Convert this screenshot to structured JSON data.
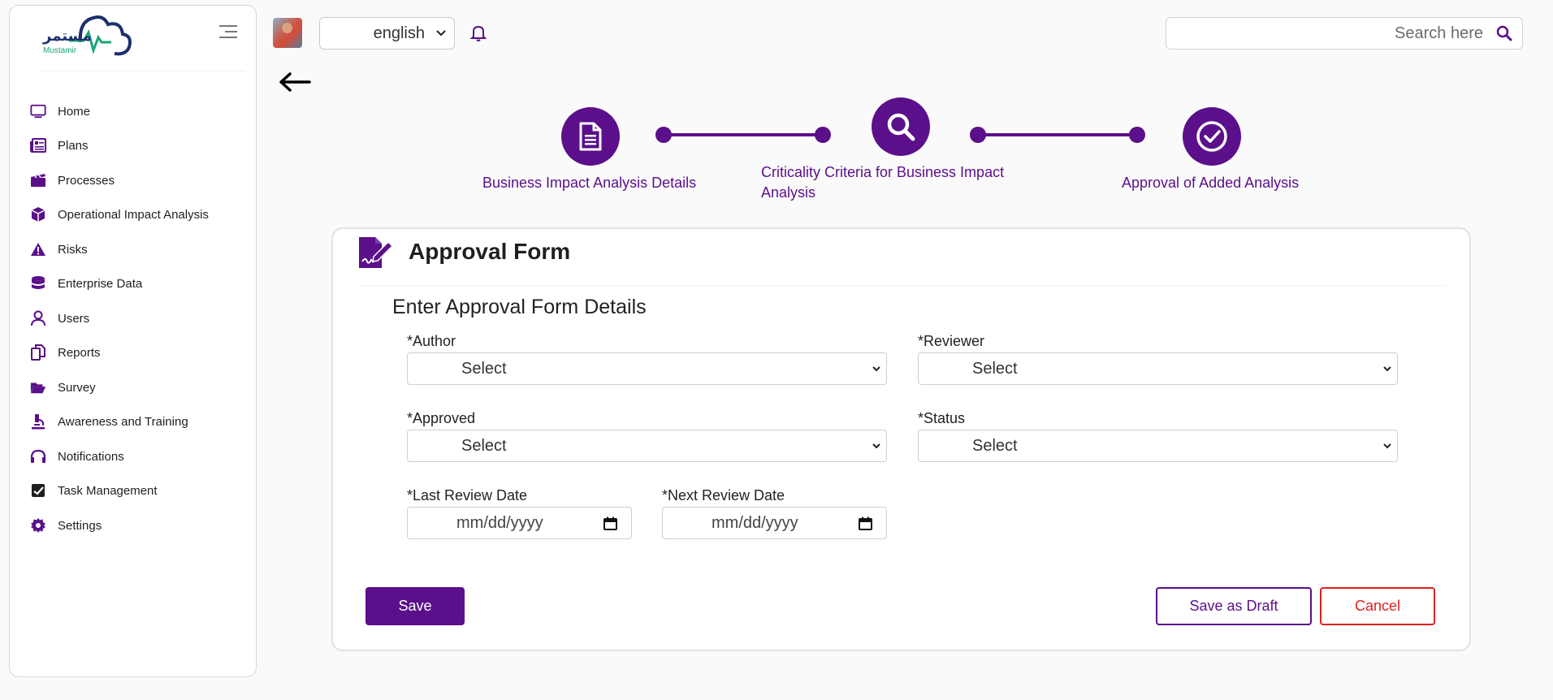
{
  "brand": {
    "arabic_name": "مستمر",
    "name": "Mustamir"
  },
  "sidebar": {
    "items": [
      {
        "label": "Home",
        "icon": "monitor-icon"
      },
      {
        "label": "Plans",
        "icon": "newspaper-icon"
      },
      {
        "label": "Processes",
        "icon": "clapperboard-icon"
      },
      {
        "label": "Operational Impact Analysis",
        "icon": "cube-icon"
      },
      {
        "label": "Risks",
        "icon": "warning-icon"
      },
      {
        "label": "Enterprise Data",
        "icon": "database-icon"
      },
      {
        "label": "Users",
        "icon": "user-icon"
      },
      {
        "label": "Reports",
        "icon": "copy-icon"
      },
      {
        "label": "Survey",
        "icon": "folder-open-icon"
      },
      {
        "label": "Awareness and Training",
        "icon": "microscope-icon"
      },
      {
        "label": "Notifications",
        "icon": "headphones-icon"
      },
      {
        "label": "Task Management",
        "icon": "task-check-icon"
      },
      {
        "label": "Settings",
        "icon": "gear-icon"
      }
    ]
  },
  "header": {
    "language": "english",
    "search_placeholder": "Search here"
  },
  "stepper": {
    "steps": [
      {
        "label": "Business Impact Analysis Details",
        "icon": "document-icon"
      },
      {
        "label": "Criticality Criteria for Business Impact Analysis",
        "icon": "search-icon"
      },
      {
        "label": "Approval of Added Analysis",
        "icon": "check-circle-icon"
      }
    ]
  },
  "form": {
    "title": "Approval Form",
    "subtitle": "Enter Approval Form Details",
    "fields": {
      "author": {
        "label": "*Author",
        "value": "Select"
      },
      "reviewer": {
        "label": "*Reviewer",
        "value": "Select"
      },
      "approved": {
        "label": "*Approved",
        "value": "Select"
      },
      "status": {
        "label": "*Status",
        "value": "Select"
      },
      "last_review_date": {
        "label": "*Last Review Date",
        "value": "mm/dd/yyyy"
      },
      "next_review_date": {
        "label": "*Next Review Date",
        "value": "mm/dd/yyyy"
      }
    },
    "buttons": {
      "save": "Save",
      "save_draft": "Save as Draft",
      "cancel": "Cancel"
    }
  },
  "colors": {
    "primary": "#5b0f8a",
    "danger": "#e02020",
    "background": "#fafafa"
  }
}
